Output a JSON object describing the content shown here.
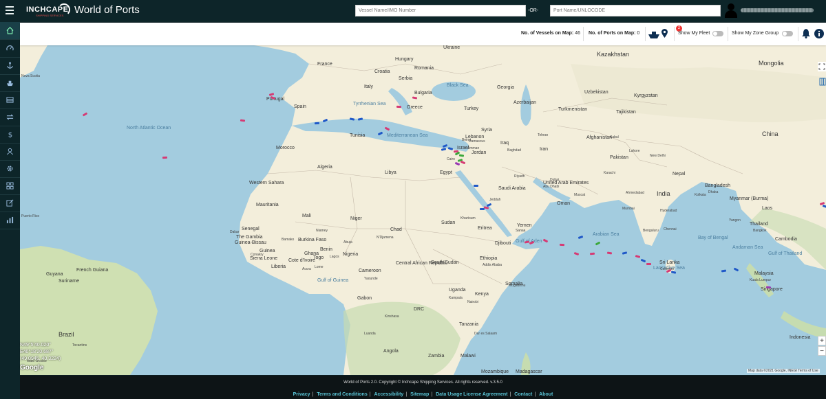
{
  "header": {
    "logo_text": "INCHCAPE",
    "logo_sub": "SHIPPING SERVICES",
    "app_title": "World of Ports",
    "vessel_search_placeholder": "Vessel Name/IMO Number",
    "or_label": "-OR-",
    "port_search_placeholder": "Port Name/UNLOCODE"
  },
  "sidebar": {
    "items": [
      "home-icon",
      "dashboard-icon",
      "anchor-icon",
      "ship-icon",
      "list-icon",
      "transfer-icon",
      "dollar-icon",
      "user-icon",
      "gear-icon",
      "grid-icon",
      "edit-icon",
      "chart-icon"
    ]
  },
  "stats": {
    "vessels_label": "No. of Vessels on Map:",
    "vessels_count": "46",
    "ports_label": "No. of Ports on Map:",
    "ports_count": "0",
    "fleet_badge": "2",
    "show_fleet_label": "Show My Fleet",
    "show_zone_label": "Show My Zone Group"
  },
  "map": {
    "labels": {
      "countries": [
        "Kazakhstan",
        "Ukraine",
        "Mongolia",
        "Romania",
        "France",
        "Croatia",
        "Italy",
        "Bulgaria",
        "Uzbekistan",
        "Kyrgyzstan",
        "Georgia",
        "Turkmenistan",
        "Tajikistan",
        "Portugal",
        "Spain",
        "Azerbaijan",
        "Greece",
        "Turkey",
        "China",
        "Syria",
        "Afghanistan",
        "Tunisia",
        "Lebanon",
        "Iraq",
        "Iran",
        "Morocco",
        "Israel",
        "Jordan",
        "Pakistan",
        "Algeria",
        "Libya",
        "Egypt",
        "Western Sahara",
        "Saudi Arabia",
        "India",
        "Bangladesh",
        "United Arab Emirates",
        "Myanmar (Burma)",
        "Mauritania",
        "Oman",
        "Laos",
        "Mali",
        "Niger",
        "Thailand",
        "Chad",
        "Sudan",
        "Eritrea",
        "Yemen",
        "Senegal",
        "The Gambia",
        "Burkina Faso",
        "Djibouti",
        "Cambodia",
        "Guinea-Bissau",
        "Guinea",
        "Benin",
        "Nigeria",
        "Sierra Leone",
        "Cote d'Ivoire",
        "Ghana",
        "South Sudan",
        "Ethiopia",
        "Liberia",
        "Togo",
        "Sri Lanka",
        "Central African Republic",
        "Cameroon",
        "Malaysia",
        "Somalia",
        "Gabon",
        "Uganda",
        "Kenya",
        "Singapore",
        "DRC",
        "Tanzania",
        "Angola",
        "Zambia",
        "Malawi",
        "Brazil",
        "Guyana",
        "Suriname",
        "French Guiana",
        "Nepal",
        "Hungary",
        "Serbia",
        "Mozambique",
        "Madagascar",
        "Indonesia"
      ],
      "seas": [
        "North Atlantic Ocean",
        "Mediterranean Sea",
        "Black Sea",
        "Tyrrhenian Sea",
        "Gulf of Aden",
        "Arabian Sea",
        "Bay of Bengal",
        "Laccadive Sea",
        "Andaman Sea",
        "Gulf of Thailand",
        "Gulf of Guinea"
      ],
      "cities": [
        "Cairo",
        "Riyadh",
        "New Delhi",
        "Abu Dhabi",
        "Dubai",
        "Hyderabad",
        "Bengaluru",
        "Chennai",
        "Colombo",
        "Lagos",
        "Abuja",
        "Accra",
        "Yaounde",
        "Nairobi",
        "Dar es Salaam",
        "Lome",
        "Kinshasa",
        "Luanda",
        "Kampala",
        "Mumbai",
        "Ahmedabad",
        "Kolkata",
        "Dhaka",
        "Bangkok",
        "Kuala Lumpur",
        "Yangon",
        "Karachi",
        "Lahore",
        "Kabul",
        "Tehran",
        "Baghdad",
        "Damascus",
        "Beirut",
        "Amman",
        "Jeddah",
        "Muscat",
        "Addis Ababa",
        "Khartoum",
        "Sanaa",
        "Mogadishu",
        "Dakar",
        "Conakry",
        "Bamako",
        "Niamey",
        "N'Djamena",
        "Puerto Rico",
        "Nova Scotia",
        "Mato Grosso",
        "Tocantins"
      ]
    },
    "coords_text": [
      "N49°5'40.020\"",
      "E40°18'20.687\"",
      "(49.0945, 40.3224)"
    ],
    "google_label": "Google",
    "attribution": "Map data ©2021 Google, INEGI   Terms of Use",
    "zoom_in": "+",
    "zoom_out": "−",
    "vessel_colors": {
      "pink": "#d63a74",
      "blue": "#1f58c8",
      "green": "#3ca83c",
      "purple": "#9a3ab2"
    }
  },
  "footer": {
    "copyright": "World of Ports 2.0. Copyright © Inchcape Shipping Services. All rights reserved. v.3.5.0",
    "links": [
      "Privacy",
      "Terms and Conditions",
      "Accessibility",
      "Sitemap",
      "Data Usage License Agreement",
      "Contact",
      "About"
    ]
  }
}
